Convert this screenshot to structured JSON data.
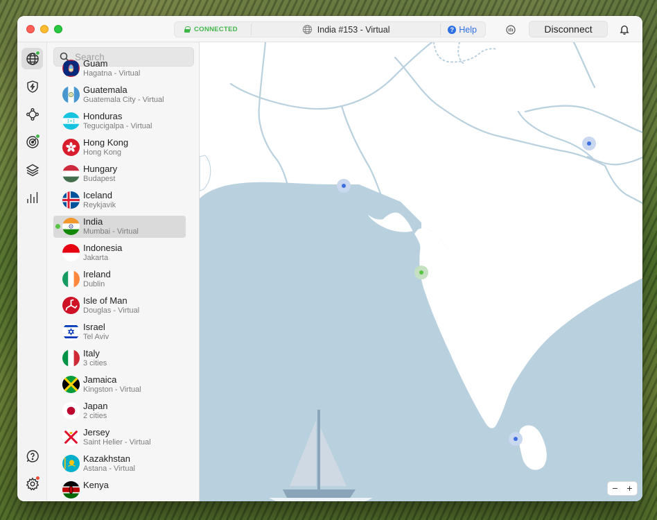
{
  "titlebar": {
    "status": "CONNECTED",
    "server": "India #153 - Virtual",
    "help": "Help",
    "disconnect": "Disconnect"
  },
  "search": {
    "placeholder": "Search"
  },
  "countries": [
    {
      "name": "Guam",
      "city": "Hagatna - Virtual",
      "flag": "guam-flag-icon"
    },
    {
      "name": "Guatemala",
      "city": "Guatemala City - Virtual",
      "flag": "guatemala-flag-icon"
    },
    {
      "name": "Honduras",
      "city": "Tegucigalpa - Virtual",
      "flag": "honduras-flag-icon"
    },
    {
      "name": "Hong Kong",
      "city": "Hong Kong",
      "flag": "hong-kong-flag-icon"
    },
    {
      "name": "Hungary",
      "city": "Budapest",
      "flag": "hungary-flag-icon"
    },
    {
      "name": "Iceland",
      "city": "Reykjavik",
      "flag": "iceland-flag-icon"
    },
    {
      "name": "India",
      "city": "Mumbai - Virtual",
      "flag": "india-flag-icon",
      "selected": true,
      "connected": true
    },
    {
      "name": "Indonesia",
      "city": "Jakarta",
      "flag": "indonesia-flag-icon"
    },
    {
      "name": "Ireland",
      "city": "Dublin",
      "flag": "ireland-flag-icon"
    },
    {
      "name": "Isle of Man",
      "city": "Douglas - Virtual",
      "flag": "isle-of-man-flag-icon"
    },
    {
      "name": "Israel",
      "city": "Tel Aviv",
      "flag": "israel-flag-icon"
    },
    {
      "name": "Italy",
      "city": "3 cities",
      "flag": "italy-flag-icon"
    },
    {
      "name": "Jamaica",
      "city": "Kingston - Virtual",
      "flag": "jamaica-flag-icon"
    },
    {
      "name": "Japan",
      "city": "2 cities",
      "flag": "japan-flag-icon"
    },
    {
      "name": "Jersey",
      "city": "Saint Helier - Virtual",
      "flag": "jersey-flag-icon"
    },
    {
      "name": "Kazakhstan",
      "city": "Astana - Virtual",
      "flag": "kazakhstan-flag-icon"
    },
    {
      "name": "Kenya",
      "city": "",
      "flag": "kenya-flag-icon"
    }
  ],
  "map": {
    "zoom_out": "−",
    "zoom_in": "+"
  },
  "colors": {
    "connected_green": "#3fb649",
    "accent_blue": "#2f6fe4",
    "water": "#b9d0df",
    "server_pin": "#3d6fe0"
  }
}
